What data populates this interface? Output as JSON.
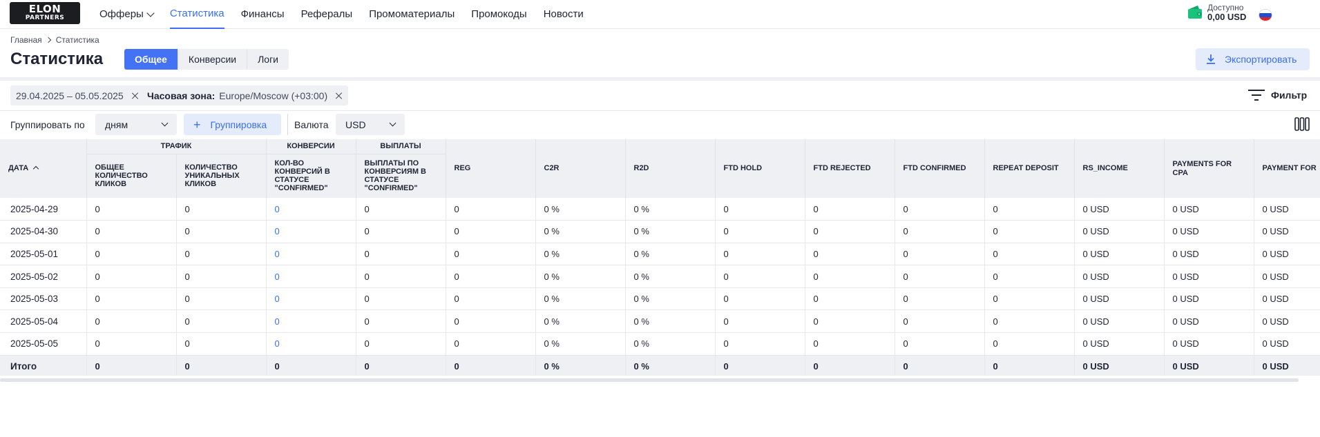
{
  "brand": {
    "line1": "ELON",
    "line2": "PARTNERS"
  },
  "nav": [
    {
      "label": "Офферы",
      "dropdown": true
    },
    {
      "label": "Статистика",
      "active": true
    },
    {
      "label": "Финансы"
    },
    {
      "label": "Рефералы"
    },
    {
      "label": "Промоматериалы"
    },
    {
      "label": "Промокоды"
    },
    {
      "label": "Новости"
    }
  ],
  "account": {
    "available_caption": "Доступно",
    "balance": "0,00 USD",
    "language_flag": "ru-flag-icon"
  },
  "breadcrumb": {
    "home": "Главная",
    "current": "Статистика"
  },
  "page": {
    "title": "Статистика"
  },
  "tabs": [
    {
      "label": "Общее",
      "active": true
    },
    {
      "label": "Конверсии"
    },
    {
      "label": "Логи"
    }
  ],
  "export": {
    "label": "Экспортировать"
  },
  "filters": {
    "date_range": "29.04.2025 – 05.05.2025",
    "timezone_label": "Часовая зона:",
    "timezone_value": "Europe/Moscow (+03:00)",
    "filter_label": "Фильтр"
  },
  "controls": {
    "group_by_label": "Группировать по",
    "group_by_value": "дням",
    "grouping_button": "Группировка",
    "currency_label": "Валюта",
    "currency_value": "USD"
  },
  "table": {
    "group_headers": {
      "traffic": "ТРАФИК",
      "conversions": "КОНВЕРСИИ",
      "payouts": "ВЫПЛАТЫ"
    },
    "columns": [
      "ДАТА",
      "ОБЩЕЕ КОЛИЧЕСТВО КЛИКОВ",
      "КОЛИЧЕСТВО УНИКАЛЬНЫХ КЛИКОВ",
      "КОЛ-ВО КОНВЕРСИЙ В СТАТУСЕ \"CONFIRMED\"",
      "ВЫПЛАТЫ ПО КОНВЕРСИЯМ В СТАТУСЕ \"CONFIRMED\"",
      "REG",
      "C2R",
      "R2D",
      "FTD HOLD",
      "FTD REJECTED",
      "FTD CONFIRMED",
      "REPEAT DEPOSIT",
      "RS_INCOME",
      "PAYMENTS FOR CPA",
      "PAYMENT FOR"
    ],
    "rows": [
      [
        "2025-04-29",
        "0",
        "0",
        "0",
        "0",
        "0",
        "0 %",
        "0 %",
        "0",
        "0",
        "0",
        "0",
        "0 USD",
        "0 USD",
        "0 USD"
      ],
      [
        "2025-04-30",
        "0",
        "0",
        "0",
        "0",
        "0",
        "0 %",
        "0 %",
        "0",
        "0",
        "0",
        "0",
        "0 USD",
        "0 USD",
        "0 USD"
      ],
      [
        "2025-05-01",
        "0",
        "0",
        "0",
        "0",
        "0",
        "0 %",
        "0 %",
        "0",
        "0",
        "0",
        "0",
        "0 USD",
        "0 USD",
        "0 USD"
      ],
      [
        "2025-05-02",
        "0",
        "0",
        "0",
        "0",
        "0",
        "0 %",
        "0 %",
        "0",
        "0",
        "0",
        "0",
        "0 USD",
        "0 USD",
        "0 USD"
      ],
      [
        "2025-05-03",
        "0",
        "0",
        "0",
        "0",
        "0",
        "0 %",
        "0 %",
        "0",
        "0",
        "0",
        "0",
        "0 USD",
        "0 USD",
        "0 USD"
      ],
      [
        "2025-05-04",
        "0",
        "0",
        "0",
        "0",
        "0",
        "0 %",
        "0 %",
        "0",
        "0",
        "0",
        "0",
        "0 USD",
        "0 USD",
        "0 USD"
      ],
      [
        "2025-05-05",
        "0",
        "0",
        "0",
        "0",
        "0",
        "0 %",
        "0 %",
        "0",
        "0",
        "0",
        "0",
        "0 USD",
        "0 USD",
        "0 USD"
      ]
    ],
    "total": [
      "Итого",
      "0",
      "0",
      "0",
      "0",
      "0",
      "0 %",
      "0 %",
      "0",
      "0",
      "0",
      "0",
      "0 USD",
      "0 USD",
      "0 USD"
    ]
  },
  "colors": {
    "accent": "#4472f5",
    "link": "#3a6ff2",
    "header_bg": "#eef0f4",
    "logo_bg": "#1c1d20",
    "wallet": "#19c37d"
  }
}
